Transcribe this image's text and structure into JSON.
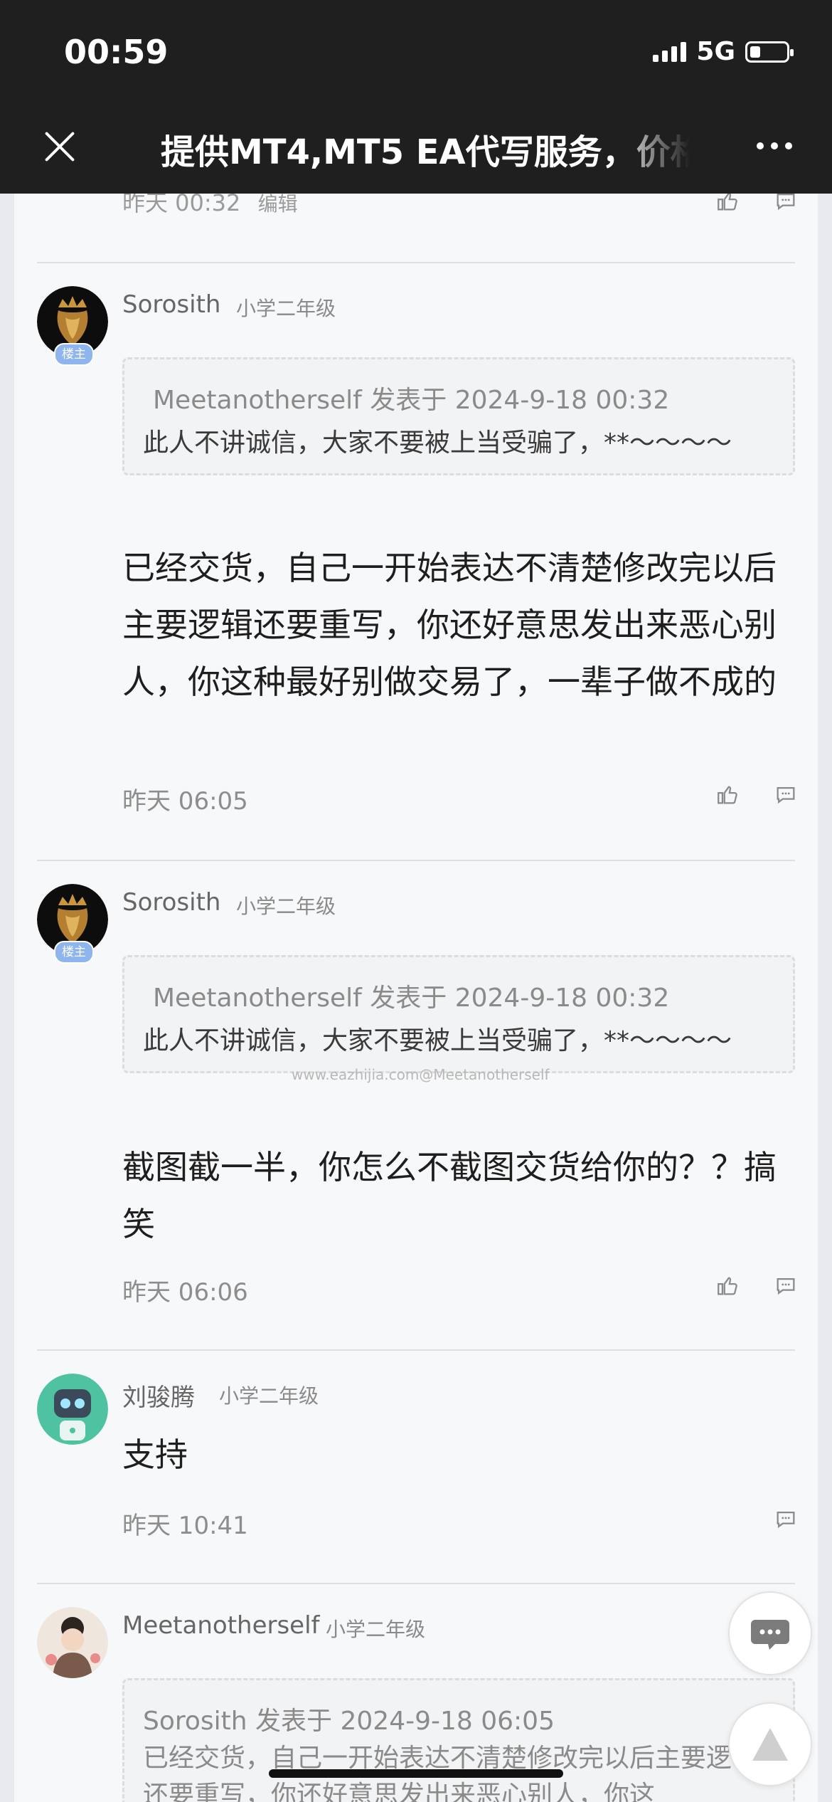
{
  "status_bar": {
    "time": "00:59",
    "network": "5G"
  },
  "nav": {
    "title": "提供MT4,MT5 EA代写服务，价格"
  },
  "top_partial": {
    "time": "昨天 00:32",
    "edit_label": "编辑"
  },
  "posts": [
    {
      "username": "Sorosith",
      "level": "小学二年级",
      "badge": "楼主",
      "quote_head": "Meetanotherself 发表于 2024-9-18 00:32",
      "quote_text": "此人不讲诚信，大家不要被上当受骗了，**～～～～",
      "body": "已经交货，自己一开始表达不清楚修改完以后主要逻辑还要重写，你还好意思发出来恶心别人，你这种最好别做交易了，一辈子做不成的",
      "time": "昨天 06:05"
    },
    {
      "username": "Sorosith",
      "level": "小学二年级",
      "badge": "楼主",
      "quote_head": "Meetanotherself 发表于 2024-9-18 00:32",
      "quote_text": "此人不讲诚信，大家不要被上当受骗了，**～～～～",
      "body": "截图截一半，你怎么不截图交货给你的？？搞笑",
      "time": "昨天 06:06"
    },
    {
      "username": "刘骏腾",
      "level": "小学二年级",
      "body": "支持",
      "time": "昨天 10:41"
    },
    {
      "username": "Meetanotherself",
      "level": "小学二年级",
      "quote_head": "Sorosith 发表于 2024-9-18 06:05",
      "quote_text": "已经交货，自己一开始表达不清楚修改完以后主要逻辑还要重写，你还好意思发出来恶心别人，你这"
    }
  ],
  "watermark": "www.eazhijia.com@Meetanotherself",
  "icons": {
    "close": "close-icon",
    "more": "more-icon",
    "like": "thumbs-up-icon",
    "comment": "comment-icon",
    "float_comment": "chat-bubble-icon",
    "back_to_top": "triangle-up-icon"
  },
  "colors": {
    "topbar": "#1f1f1f",
    "page": "#f7f8fa",
    "badge": "#8eb5ee"
  }
}
